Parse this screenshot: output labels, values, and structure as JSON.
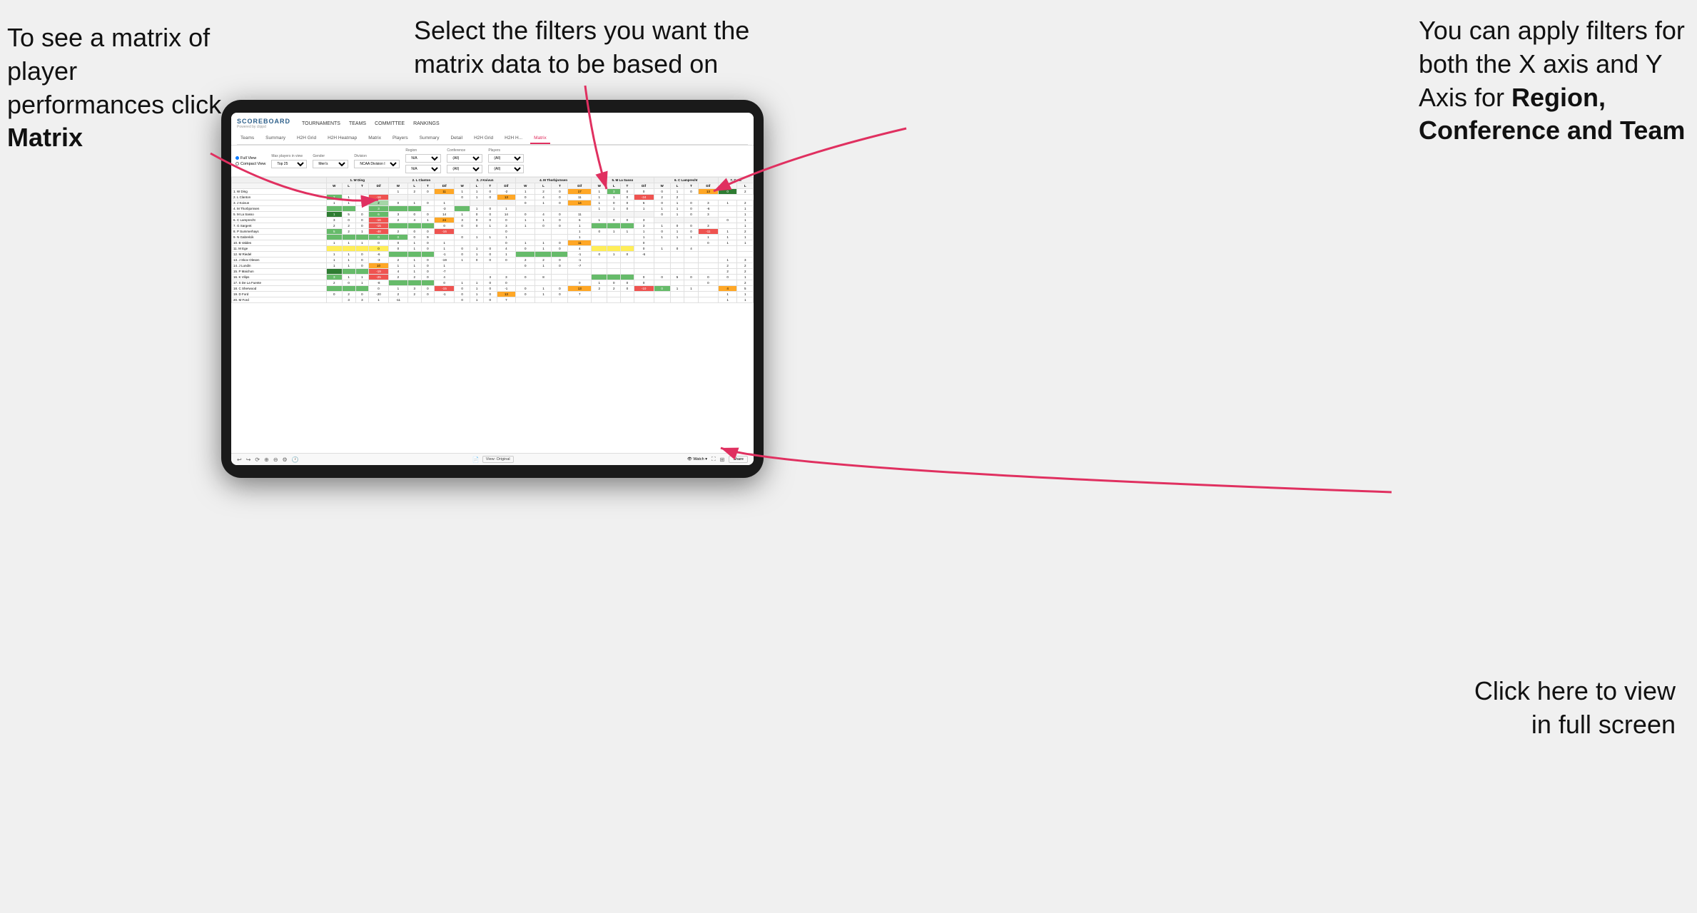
{
  "annotations": {
    "matrix_text": "To see a matrix of player performances click ",
    "matrix_bold": "Matrix",
    "filters_text": "Select the filters you want the matrix data to be based on",
    "axis_text": "You  can apply filters for both the X axis and Y Axis for ",
    "axis_bold": "Region, Conference and Team",
    "fullscreen_text": "Click here to view in full screen"
  },
  "nav": {
    "logo": "SCOREBOARD",
    "logo_sub": "Powered by clippd",
    "items": [
      "TOURNAMENTS",
      "TEAMS",
      "COMMITTEE",
      "RANKINGS"
    ]
  },
  "tabs": {
    "sub_tabs": [
      "Teams",
      "Summary",
      "H2H Grid",
      "H2H Heatmap",
      "Matrix",
      "Players",
      "Summary",
      "Detail",
      "H2H Grid",
      "H2H H...",
      "Matrix"
    ]
  },
  "filters": {
    "view_options": [
      "Full View",
      "Compact View"
    ],
    "max_players_label": "Max players in view",
    "max_players_value": "Top 25",
    "gender_label": "Gender",
    "gender_value": "Men's",
    "division_label": "Division",
    "division_value": "NCAA Division I",
    "region_label": "Region",
    "region_value": "N/A",
    "conference_label": "Conference",
    "conference_value": "(All)",
    "players_label": "Players",
    "players_value": "(All)"
  },
  "matrix": {
    "col_headers": [
      "1. W Ding",
      "2. L Clanton",
      "3. J Koivun",
      "4. M Thorbjornsen",
      "5. M La Sasso",
      "6. C Lamprecht",
      "7. G Sa"
    ],
    "sub_headers": [
      "W",
      "L",
      "T",
      "Dif"
    ],
    "rows": [
      {
        "name": "1. W Ding",
        "cells": [
          {
            "v": "",
            "c": "c-white"
          },
          {
            "v": "1",
            "c": "c-white"
          },
          {
            "v": "2",
            "c": "c-white"
          },
          {
            "v": "0",
            "c": "c-white"
          },
          {
            "v": "11",
            "c": "c-orange"
          }
        ]
      },
      {
        "name": "2. L Clanton",
        "cells": [
          {
            "v": "2",
            "c": "c-green"
          },
          {
            "v": "",
            "c": "c-white"
          },
          {
            "v": "",
            "c": "c-white"
          },
          {
            "v": "0",
            "c": "c-white"
          },
          {
            "v": "-18",
            "c": "num-neg"
          }
        ]
      },
      {
        "name": "3. J Koivun",
        "cells": [
          {
            "v": "1",
            "c": "c-white"
          },
          {
            "v": "1",
            "c": "c-white"
          },
          {
            "v": "0",
            "c": "c-white"
          },
          {
            "v": "2",
            "c": "c-green-light"
          }
        ]
      },
      {
        "name": "4. M Thorbjornsen",
        "cells": [
          {
            "v": "",
            "c": "c-green"
          },
          {
            "v": "",
            "c": "c-green"
          }
        ]
      },
      {
        "name": "5. M La Sasso",
        "cells": [
          {
            "v": "1",
            "c": "c-white"
          },
          {
            "v": "5",
            "c": "c-green"
          },
          {
            "v": "0",
            "c": "c-white"
          },
          {
            "v": "6",
            "c": "c-green"
          }
        ]
      },
      {
        "name": "6. C Lamprecht",
        "cells": [
          {
            "v": "3",
            "c": "c-white"
          },
          {
            "v": "0",
            "c": "c-white"
          },
          {
            "v": "0",
            "c": "c-white"
          },
          {
            "v": "-16",
            "c": "num-neg"
          }
        ]
      },
      {
        "name": "7. G Sargent",
        "cells": [
          {
            "v": "2",
            "c": "c-white"
          },
          {
            "v": "2",
            "c": "c-white"
          },
          {
            "v": "0",
            "c": "c-white"
          },
          {
            "v": "-15",
            "c": "num-neg"
          }
        ]
      },
      {
        "name": "8. P Summerhays",
        "cells": [
          {
            "v": "5",
            "c": "c-green"
          },
          {
            "v": "2",
            "c": "c-white"
          },
          {
            "v": "1",
            "c": "c-white"
          },
          {
            "v": "-48",
            "c": "num-neg"
          }
        ]
      },
      {
        "name": "9. N Gabrelcik",
        "cells": []
      },
      {
        "name": "10. B Valdes",
        "cells": [
          {
            "v": "1",
            "c": "c-white"
          },
          {
            "v": "1",
            "c": "c-white"
          },
          {
            "v": "1",
            "c": "c-white"
          },
          {
            "v": "0",
            "c": "c-white"
          }
        ]
      },
      {
        "name": "11. M Ege",
        "cells": []
      },
      {
        "name": "12. M Riedel",
        "cells": [
          {
            "v": "1",
            "c": "c-white"
          },
          {
            "v": "1",
            "c": "c-white"
          },
          {
            "v": "0",
            "c": "c-white"
          },
          {
            "v": "-6",
            "c": "num-neg"
          }
        ]
      },
      {
        "name": "13. J Skov Olesen",
        "cells": [
          {
            "v": "1",
            "c": "c-white"
          },
          {
            "v": "1",
            "c": "c-white"
          },
          {
            "v": "0",
            "c": "c-white"
          },
          {
            "v": "-3",
            "c": "num-neg"
          }
        ]
      },
      {
        "name": "14. J Lundin",
        "cells": [
          {
            "v": "1",
            "c": "c-white"
          },
          {
            "v": "1",
            "c": "c-white"
          },
          {
            "v": "0",
            "c": "c-white"
          },
          {
            "v": "10",
            "c": "c-orange"
          }
        ]
      },
      {
        "name": "15. P Maichon",
        "cells": [
          {
            "v": "",
            "c": "c-green"
          },
          {
            "v": "",
            "c": "c-green"
          },
          {
            "v": "",
            "c": "c-green"
          },
          {
            "v": "-19",
            "c": "num-neg"
          }
        ]
      },
      {
        "name": "16. K Vilips",
        "cells": [
          {
            "v": "3",
            "c": "c-white"
          },
          {
            "v": "1",
            "c": "c-white"
          },
          {
            "v": "1",
            "c": "c-white"
          },
          {
            "v": "-25",
            "c": "num-neg"
          }
        ]
      },
      {
        "name": "17. S De La Fuente",
        "cells": [
          {
            "v": "2",
            "c": "c-white"
          },
          {
            "v": "0",
            "c": "c-white"
          },
          {
            "v": "1",
            "c": "c-white"
          },
          {
            "v": "-8",
            "c": "num-neg"
          }
        ]
      },
      {
        "name": "18. C Sherwood",
        "cells": [
          {
            "v": "",
            "c": "c-green"
          },
          {
            "v": "1",
            "c": "c-white"
          },
          {
            "v": "3",
            "c": "c-white"
          },
          {
            "v": "0",
            "c": "c-white"
          }
        ]
      },
      {
        "name": "19. D Ford",
        "cells": [
          {
            "v": "2",
            "c": "c-white"
          },
          {
            "v": "2",
            "c": "c-white"
          },
          {
            "v": "0",
            "c": "c-white"
          },
          {
            "v": "-20",
            "c": "num-neg"
          }
        ]
      },
      {
        "name": "20. M Ford",
        "cells": [
          {
            "v": "",
            "c": "c-white"
          },
          {
            "v": "3",
            "c": "c-white"
          },
          {
            "v": "3",
            "c": "c-white"
          },
          {
            "v": "1",
            "c": "c-white"
          },
          {
            "v": "-11",
            "c": "num-neg"
          }
        ]
      }
    ]
  },
  "toolbar": {
    "view_label": "View: Original",
    "watch_label": "Watch",
    "share_label": "Share"
  }
}
